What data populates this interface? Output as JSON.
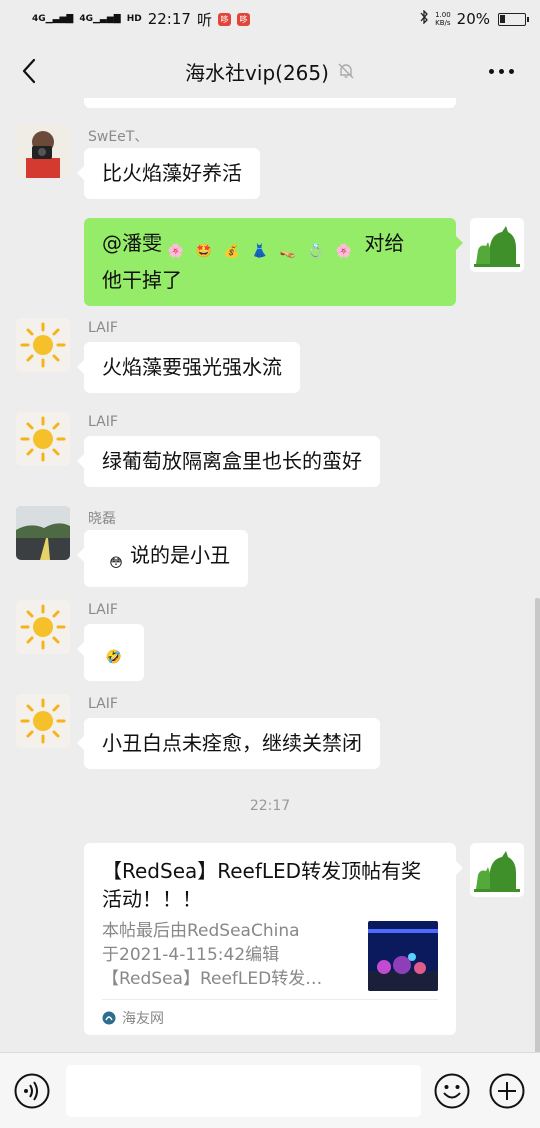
{
  "status_bar": {
    "net1": "4G",
    "net2": "4G",
    "hd": "HD",
    "time": "22:17",
    "app_badge": "听",
    "badge2": "哆",
    "badge3": "哆",
    "speed": "1.00",
    "speed_unit": "KB/s",
    "battery": "20%"
  },
  "nav": {
    "title": "海水社vip(265)"
  },
  "messages": [
    {
      "sender": "SwEeT、",
      "text": "比火焰藻好养活"
    },
    {
      "text_prefix": "@潘雯",
      "emojis": [
        "🌸",
        "🤩",
        "💰",
        "👗",
        "👡",
        "💍",
        "🌸"
      ],
      "text_suffix": " 对给",
      "text_line2": "他干掉了"
    },
    {
      "sender": "LAIF",
      "text": "火焰藻要强光强水流"
    },
    {
      "sender": "LAIF",
      "text": "绿葡萄放隔离盒里也长的蛮好"
    },
    {
      "sender": "晓磊",
      "emoji": "😳",
      "text": "说的是小丑"
    },
    {
      "sender": "LAIF",
      "emoji": "🤣"
    },
    {
      "sender": "LAIF",
      "text": "小丑白点未痊愈，继续关禁闭"
    }
  ],
  "timestamp": "22:17",
  "link_card": {
    "title": "【RedSea】ReefLED转发顶帖有奖活动！！！",
    "desc_line1": "本帖最后由RedSeaChina",
    "desc_line2": "于2021-4-115:42编辑",
    "desc_line3": "【RedSea】ReefLED转发…",
    "source": "海友网"
  },
  "icons": {
    "back": "chevron-left-icon",
    "mute": "bell-off-icon",
    "more": "more-icon",
    "voice": "voice-icon",
    "emoji": "emoji-icon",
    "plus": "plus-icon"
  },
  "colors": {
    "background": "#ededed",
    "my_bubble": "#95ec69",
    "other_bubble": "#ffffff",
    "sender_text": "#8a8a8a"
  }
}
